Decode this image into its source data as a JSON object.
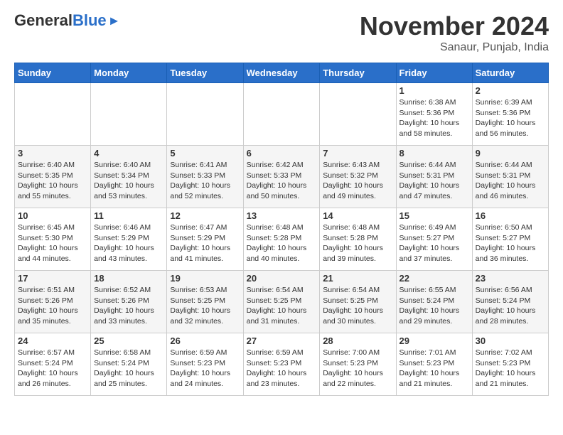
{
  "header": {
    "logo_general": "General",
    "logo_blue": "Blue",
    "month_title": "November 2024",
    "location": "Sanaur, Punjab, India"
  },
  "days_of_week": [
    "Sunday",
    "Monday",
    "Tuesday",
    "Wednesday",
    "Thursday",
    "Friday",
    "Saturday"
  ],
  "weeks": [
    {
      "cells": [
        {
          "day": "",
          "info": ""
        },
        {
          "day": "",
          "info": ""
        },
        {
          "day": "",
          "info": ""
        },
        {
          "day": "",
          "info": ""
        },
        {
          "day": "",
          "info": ""
        },
        {
          "day": "1",
          "info": "Sunrise: 6:38 AM\nSunset: 5:36 PM\nDaylight: 10 hours\nand 58 minutes."
        },
        {
          "day": "2",
          "info": "Sunrise: 6:39 AM\nSunset: 5:36 PM\nDaylight: 10 hours\nand 56 minutes."
        }
      ]
    },
    {
      "cells": [
        {
          "day": "3",
          "info": "Sunrise: 6:40 AM\nSunset: 5:35 PM\nDaylight: 10 hours\nand 55 minutes."
        },
        {
          "day": "4",
          "info": "Sunrise: 6:40 AM\nSunset: 5:34 PM\nDaylight: 10 hours\nand 53 minutes."
        },
        {
          "day": "5",
          "info": "Sunrise: 6:41 AM\nSunset: 5:33 PM\nDaylight: 10 hours\nand 52 minutes."
        },
        {
          "day": "6",
          "info": "Sunrise: 6:42 AM\nSunset: 5:33 PM\nDaylight: 10 hours\nand 50 minutes."
        },
        {
          "day": "7",
          "info": "Sunrise: 6:43 AM\nSunset: 5:32 PM\nDaylight: 10 hours\nand 49 minutes."
        },
        {
          "day": "8",
          "info": "Sunrise: 6:44 AM\nSunset: 5:31 PM\nDaylight: 10 hours\nand 47 minutes."
        },
        {
          "day": "9",
          "info": "Sunrise: 6:44 AM\nSunset: 5:31 PM\nDaylight: 10 hours\nand 46 minutes."
        }
      ]
    },
    {
      "cells": [
        {
          "day": "10",
          "info": "Sunrise: 6:45 AM\nSunset: 5:30 PM\nDaylight: 10 hours\nand 44 minutes."
        },
        {
          "day": "11",
          "info": "Sunrise: 6:46 AM\nSunset: 5:29 PM\nDaylight: 10 hours\nand 43 minutes."
        },
        {
          "day": "12",
          "info": "Sunrise: 6:47 AM\nSunset: 5:29 PM\nDaylight: 10 hours\nand 41 minutes."
        },
        {
          "day": "13",
          "info": "Sunrise: 6:48 AM\nSunset: 5:28 PM\nDaylight: 10 hours\nand 40 minutes."
        },
        {
          "day": "14",
          "info": "Sunrise: 6:48 AM\nSunset: 5:28 PM\nDaylight: 10 hours\nand 39 minutes."
        },
        {
          "day": "15",
          "info": "Sunrise: 6:49 AM\nSunset: 5:27 PM\nDaylight: 10 hours\nand 37 minutes."
        },
        {
          "day": "16",
          "info": "Sunrise: 6:50 AM\nSunset: 5:27 PM\nDaylight: 10 hours\nand 36 minutes."
        }
      ]
    },
    {
      "cells": [
        {
          "day": "17",
          "info": "Sunrise: 6:51 AM\nSunset: 5:26 PM\nDaylight: 10 hours\nand 35 minutes."
        },
        {
          "day": "18",
          "info": "Sunrise: 6:52 AM\nSunset: 5:26 PM\nDaylight: 10 hours\nand 33 minutes."
        },
        {
          "day": "19",
          "info": "Sunrise: 6:53 AM\nSunset: 5:25 PM\nDaylight: 10 hours\nand 32 minutes."
        },
        {
          "day": "20",
          "info": "Sunrise: 6:54 AM\nSunset: 5:25 PM\nDaylight: 10 hours\nand 31 minutes."
        },
        {
          "day": "21",
          "info": "Sunrise: 6:54 AM\nSunset: 5:25 PM\nDaylight: 10 hours\nand 30 minutes."
        },
        {
          "day": "22",
          "info": "Sunrise: 6:55 AM\nSunset: 5:24 PM\nDaylight: 10 hours\nand 29 minutes."
        },
        {
          "day": "23",
          "info": "Sunrise: 6:56 AM\nSunset: 5:24 PM\nDaylight: 10 hours\nand 28 minutes."
        }
      ]
    },
    {
      "cells": [
        {
          "day": "24",
          "info": "Sunrise: 6:57 AM\nSunset: 5:24 PM\nDaylight: 10 hours\nand 26 minutes."
        },
        {
          "day": "25",
          "info": "Sunrise: 6:58 AM\nSunset: 5:24 PM\nDaylight: 10 hours\nand 25 minutes."
        },
        {
          "day": "26",
          "info": "Sunrise: 6:59 AM\nSunset: 5:23 PM\nDaylight: 10 hours\nand 24 minutes."
        },
        {
          "day": "27",
          "info": "Sunrise: 6:59 AM\nSunset: 5:23 PM\nDaylight: 10 hours\nand 23 minutes."
        },
        {
          "day": "28",
          "info": "Sunrise: 7:00 AM\nSunset: 5:23 PM\nDaylight: 10 hours\nand 22 minutes."
        },
        {
          "day": "29",
          "info": "Sunrise: 7:01 AM\nSunset: 5:23 PM\nDaylight: 10 hours\nand 21 minutes."
        },
        {
          "day": "30",
          "info": "Sunrise: 7:02 AM\nSunset: 5:23 PM\nDaylight: 10 hours\nand 21 minutes."
        }
      ]
    }
  ]
}
